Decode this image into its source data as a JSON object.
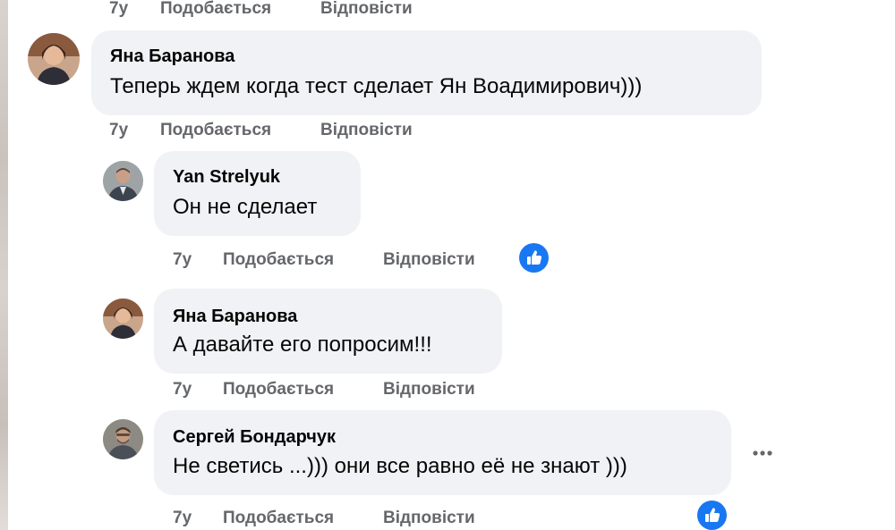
{
  "actions": {
    "like_label": "Подобається",
    "reply_label": "Відповісти"
  },
  "top_meta": {
    "time": "7y"
  },
  "comments": [
    {
      "author": "Яна Баранова",
      "text": "Теперь ждем когда тест сделает Ян Воадимирович)))",
      "time": "7y"
    },
    {
      "author": "Yan Strelyuk",
      "text": "Он не сделает",
      "time": "7y"
    },
    {
      "author": "Яна Баранова",
      "text": "А давайте его попросим!!!",
      "time": "7y"
    },
    {
      "author": "Сергей Бондарчук",
      "text": "Не светись ...))) они все равно её не знают )))",
      "time": "7y"
    }
  ],
  "colors": {
    "bubble": "#f0f2f5",
    "meta_text": "#65676b",
    "like_blue": "#1877f2"
  },
  "icons": {
    "like": "thumbs-up-icon",
    "more": "more-dots-icon"
  }
}
